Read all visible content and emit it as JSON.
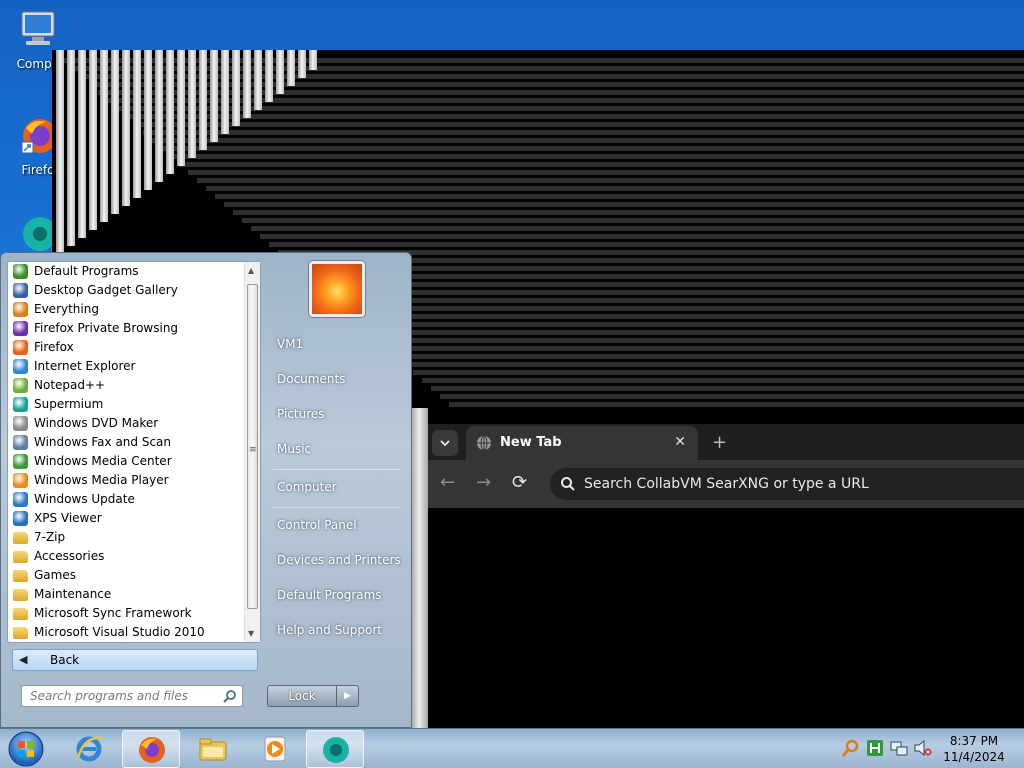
{
  "desktop": {
    "icons": [
      {
        "label": "Compu"
      },
      {
        "label": "Firefo"
      }
    ]
  },
  "browser": {
    "tab_title": "New Tab",
    "close_symbol": "✕",
    "new_tab_symbol": "+",
    "back_symbol": "←",
    "forward_symbol": "→",
    "reload_symbol": "⟳",
    "omnibox_placeholder": "Search CollabVM SearXNG or type a URL"
  },
  "start_menu": {
    "programs": [
      {
        "label": "Default Programs",
        "icon": "default-programs-icon",
        "color": "#3a8f2a"
      },
      {
        "label": "Desktop Gadget Gallery",
        "icon": "gadget-gallery-icon",
        "color": "#3a5fa8"
      },
      {
        "label": "Everything",
        "icon": "everything-icon",
        "color": "#e07b1a"
      },
      {
        "label": "Firefox Private Browsing",
        "icon": "firefox-private-icon",
        "color": "#6b2fb0"
      },
      {
        "label": "Firefox",
        "icon": "firefox-icon",
        "color": "#e8611a"
      },
      {
        "label": "Internet Explorer",
        "icon": "internet-explorer-icon",
        "color": "#2f86d6"
      },
      {
        "label": "Notepad++",
        "icon": "notepad-plus-plus-icon",
        "color": "#6fae3a"
      },
      {
        "label": "Supermium",
        "icon": "supermium-icon",
        "color": "#17a39a"
      },
      {
        "label": "Windows DVD Maker",
        "icon": "dvd-maker-icon",
        "color": "#8a8a8a"
      },
      {
        "label": "Windows Fax and Scan",
        "icon": "fax-scan-icon",
        "color": "#5d7ea6"
      },
      {
        "label": "Windows Media Center",
        "icon": "media-center-icon",
        "color": "#3b9a3b"
      },
      {
        "label": "Windows Media Player",
        "icon": "media-player-icon",
        "color": "#e88b1a"
      },
      {
        "label": "Windows Update",
        "icon": "windows-update-icon",
        "color": "#2f76c8"
      },
      {
        "label": "XPS Viewer",
        "icon": "xps-viewer-icon",
        "color": "#2a6fc4"
      },
      {
        "label": "7-Zip",
        "icon": "folder-icon",
        "folder": true
      },
      {
        "label": "Accessories",
        "icon": "folder-icon",
        "folder": true
      },
      {
        "label": "Games",
        "icon": "folder-icon",
        "folder": true
      },
      {
        "label": "Maintenance",
        "icon": "folder-icon",
        "folder": true
      },
      {
        "label": "Microsoft Sync Framework",
        "icon": "folder-icon",
        "folder": true
      },
      {
        "label": "Microsoft Visual Studio 2010",
        "icon": "folder-icon",
        "folder": true
      }
    ],
    "back_label": "Back",
    "search_placeholder": "Search programs and files",
    "right_items": [
      {
        "label": "VM1"
      },
      {
        "label": "Documents"
      },
      {
        "label": "Pictures"
      },
      {
        "label": "Music"
      },
      {
        "label": "Computer"
      },
      {
        "label": "Control Panel"
      },
      {
        "label": "Devices and Printers"
      },
      {
        "label": "Default Programs"
      },
      {
        "label": "Help and Support"
      }
    ],
    "lock_label": "Lock"
  },
  "taskbar": {
    "time": "8:37 PM",
    "date": "11/4/2024"
  }
}
